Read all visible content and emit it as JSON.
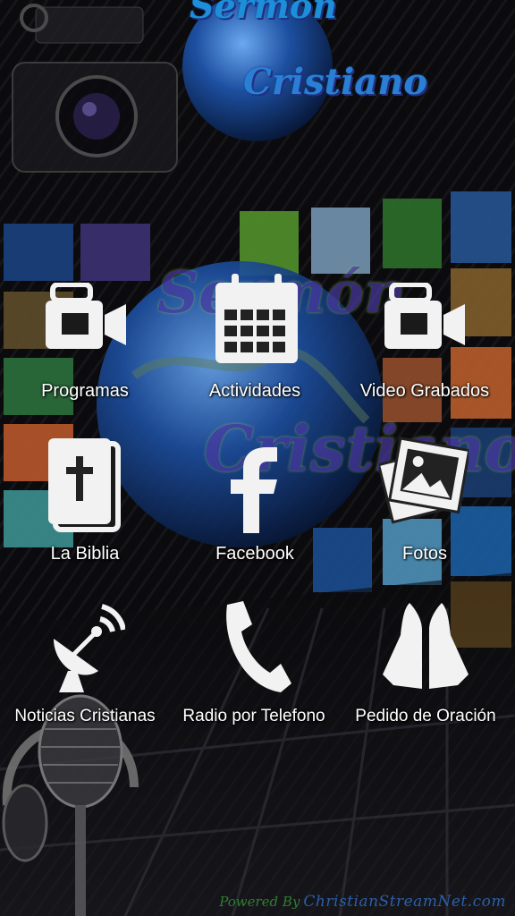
{
  "header": {
    "logo_line1": "Sermón",
    "logo_line2": "Cristiano"
  },
  "background": {
    "watermark_line1": "Sermón",
    "watermark_line2": "Cristiano"
  },
  "menu": {
    "items": [
      {
        "label": "Programas",
        "icon": "video-camera-icon"
      },
      {
        "label": "Actividades",
        "icon": "calendar-icon"
      },
      {
        "label": "Video Grabados",
        "icon": "video-camera-icon"
      },
      {
        "label": "La Biblia",
        "icon": "bible-icon"
      },
      {
        "label": "Facebook",
        "icon": "facebook-icon"
      },
      {
        "label": "Fotos",
        "icon": "photos-icon"
      },
      {
        "label": "Noticias Cristianas",
        "icon": "satellite-dish-icon"
      },
      {
        "label": "Radio por Telefono",
        "icon": "phone-icon"
      },
      {
        "label": "Pedido de Oración",
        "icon": "praying-hands-icon"
      }
    ]
  },
  "footer": {
    "powered_by": "Powered By",
    "brand": "ChristianStreamNet.com"
  },
  "colors": {
    "background": "#050507",
    "label": "#ffffff",
    "logo_blue": "#1d8fd8",
    "logo_green": "#7dc242",
    "logo_purple": "#5a3fb0"
  }
}
